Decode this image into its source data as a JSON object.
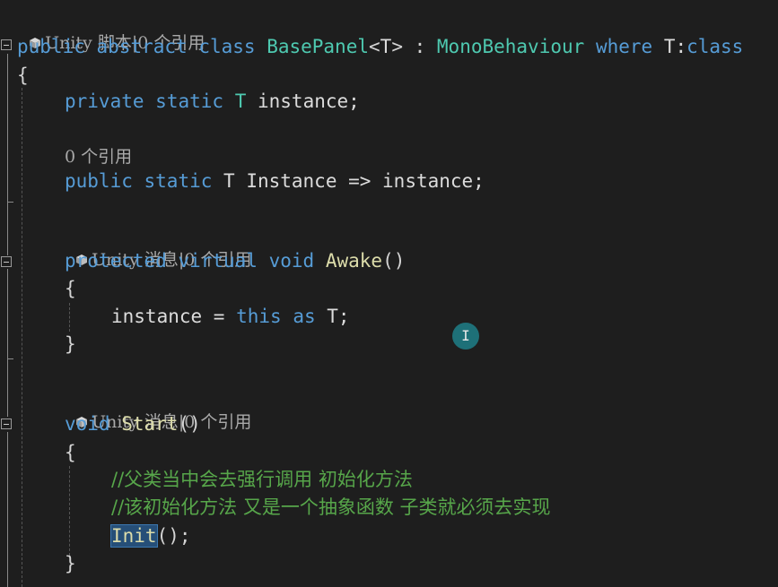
{
  "hints": {
    "class_hint": "Unity 脚本|0 个引用",
    "instance_refs": "0 个引用",
    "awake_hint": "Unity 消息|0 个引用",
    "start_hint": "Unity 消息|0 个引用"
  },
  "code": {
    "l1": {
      "kw1": "public",
      "kw2": "abstract",
      "kw3": "class",
      "name": "BasePanel",
      "lt": "<",
      "tparam": "T",
      "gt": ">",
      "colon": " : ",
      "base": "MonoBehaviour",
      "where": "where",
      "tp2": "T:",
      "kw4": "class"
    },
    "l2": {
      "brace": "{"
    },
    "l3": {
      "kw1": "private",
      "kw2": "static",
      "t": "T",
      "rest": "instance;"
    },
    "l4": {
      "kw1": "public",
      "kw2": "static",
      "rest": "T Instance => instance;"
    },
    "l5": {
      "kw1": "protected",
      "kw2": "virtual",
      "kw3": "void",
      "fn": "Awake",
      "paren": "()"
    },
    "l6": {
      "brace": "{"
    },
    "l7": {
      "pre": "instance = ",
      "kw": "this",
      "mid": " ",
      "kw2": "as",
      "post": " T;"
    },
    "l8": {
      "brace": "}"
    },
    "l9": {
      "kw": "void",
      "fn": "Start",
      "paren": "()"
    },
    "l10": {
      "brace": "{"
    },
    "l11": {
      "comment": "//父类当中会去强行调用 初始化方法"
    },
    "l12": {
      "comment": "//该初始化方法 又是一个抽象函数 子类就必须去实现"
    },
    "l13": {
      "fn": "Init",
      "rest": "();"
    },
    "l14": {
      "brace": "}"
    }
  },
  "icons": {
    "unity_icon": "unity-cube-icon",
    "fold_icon": "collapse-minus-icon",
    "cursor_icon": "text-cursor-icon"
  }
}
